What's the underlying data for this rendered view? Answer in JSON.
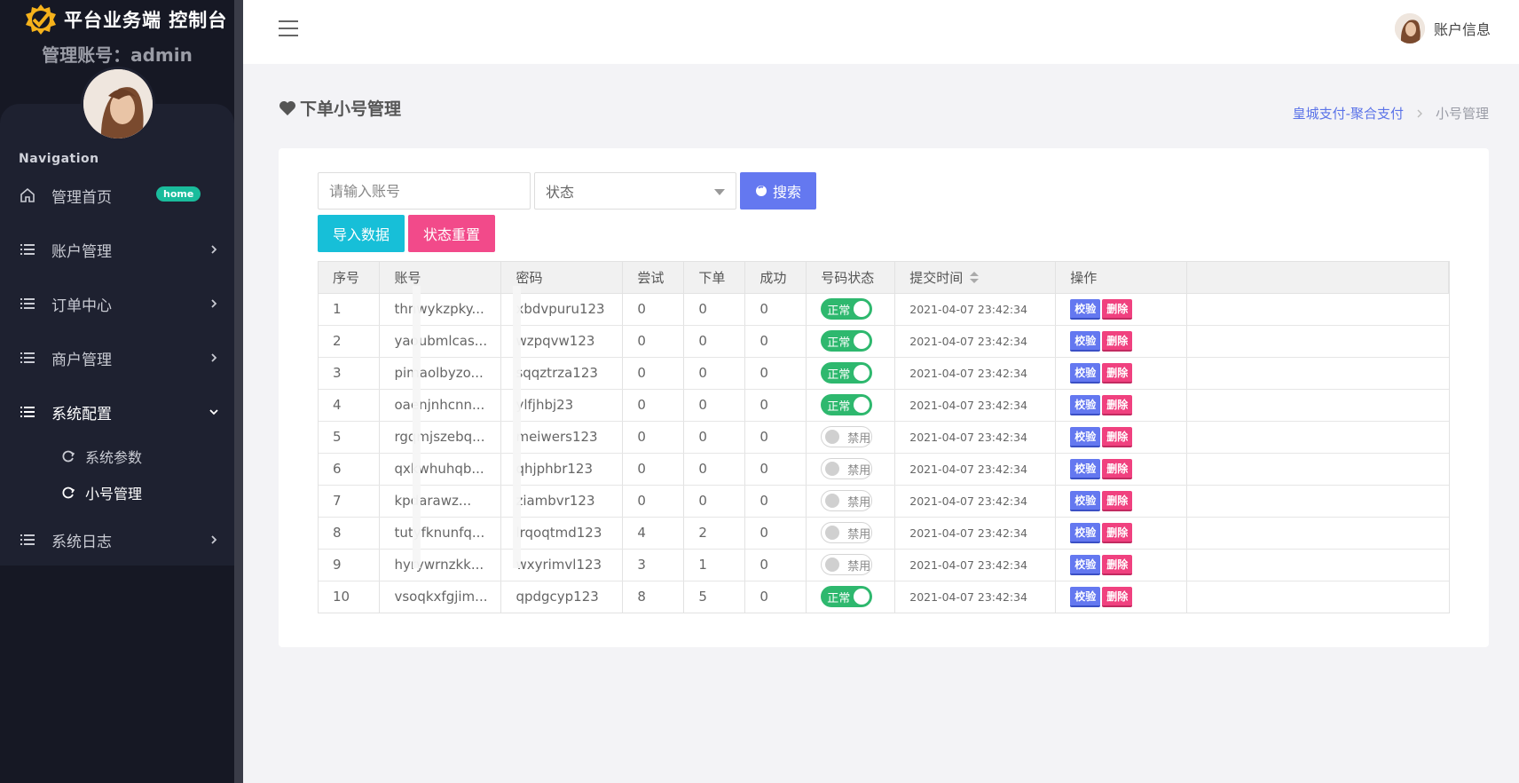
{
  "sidebar": {
    "brand_title": "平台业务端 控制台",
    "admin_label": "管理账号：admin",
    "nav_heading": "Navigation",
    "items": [
      {
        "label": "管理首页",
        "badge": "home",
        "icon": "home-icon"
      },
      {
        "label": "账户管理",
        "icon": "list-icon"
      },
      {
        "label": "订单中心",
        "icon": "list-icon"
      },
      {
        "label": "商户管理",
        "icon": "list-icon"
      },
      {
        "label": "系统配置",
        "icon": "list-icon",
        "expanded": true
      },
      {
        "label": "系统日志",
        "icon": "list-icon"
      }
    ],
    "sub_items": [
      {
        "label": "系统参数",
        "icon": "refresh-icon"
      },
      {
        "label": "小号管理",
        "icon": "refresh-icon",
        "active": true
      }
    ]
  },
  "topbar": {
    "account_label": "账户信息"
  },
  "page": {
    "title": "下单小号管理",
    "breadcrumb": {
      "link": "皇城支付-聚合支付",
      "current": "小号管理"
    }
  },
  "filters": {
    "account_placeholder": "请输入账号",
    "status_selected": "状态",
    "search_label": "搜索",
    "import_label": "导入数据",
    "reset_label": "状态重置"
  },
  "table": {
    "headers": [
      "序号",
      "账号",
      "密码",
      "尝试",
      "下单",
      "成功",
      "号码状态",
      "提交时间",
      "操作"
    ],
    "rows": [
      {
        "no": "1",
        "account": "thnwykzpky...",
        "password": "xbdvpuru123",
        "try": "0",
        "order": "0",
        "success": "0",
        "status": "正常",
        "on": true,
        "time": "2021-04-07 23:42:34"
      },
      {
        "no": "2",
        "account": "yaoubmlcas...",
        "password": "wzpqvw123",
        "try": "0",
        "order": "0",
        "success": "0",
        "status": "正常",
        "on": true,
        "time": "2021-04-07 23:42:34"
      },
      {
        "no": "3",
        "account": "pimaolbyzo...",
        "password": "sqqztrza123",
        "try": "0",
        "order": "0",
        "success": "0",
        "status": "正常",
        "on": true,
        "time": "2021-04-07 23:42:34"
      },
      {
        "no": "4",
        "account": "oaenjnhcnn...",
        "password": "ylfjhbj23",
        "try": "0",
        "order": "0",
        "success": "0",
        "status": "正常",
        "on": true,
        "time": "2021-04-07 23:42:34"
      },
      {
        "no": "5",
        "account": "rgqmjszebq...",
        "password": "meiwers123",
        "try": "0",
        "order": "0",
        "success": "0",
        "status": "禁用",
        "on": false,
        "time": "2021-04-07 23:42:34"
      },
      {
        "no": "6",
        "account": "qxkwhuhqb...",
        "password": "qhjphbr123",
        "try": "0",
        "order": "0",
        "success": "0",
        "status": "禁用",
        "on": false,
        "time": "2021-04-07 23:42:34"
      },
      {
        "no": "7",
        "account": "kpdarawz...",
        "password": "ziambvr123",
        "try": "0",
        "order": "0",
        "success": "0",
        "status": "禁用",
        "on": false,
        "time": "2021-04-07 23:42:34"
      },
      {
        "no": "8",
        "account": "tutyfknunfq...",
        "password": "lrqoqtmd123",
        "try": "4",
        "order": "2",
        "success": "0",
        "status": "禁用",
        "on": false,
        "time": "2021-04-07 23:42:34"
      },
      {
        "no": "9",
        "account": "hyrywrnzkk...",
        "password": "wxyrimvl123",
        "try": "3",
        "order": "1",
        "success": "0",
        "status": "禁用",
        "on": false,
        "time": "2021-04-07 23:42:34"
      },
      {
        "no": "10",
        "account": "vsoqkxfgjim...",
        "password": "qpdgcyp123",
        "try": "8",
        "order": "5",
        "success": "0",
        "status": "正常",
        "on": true,
        "time": "2021-04-07 23:42:34"
      }
    ],
    "actions": {
      "check": "校验",
      "delete": "删除"
    }
  }
}
